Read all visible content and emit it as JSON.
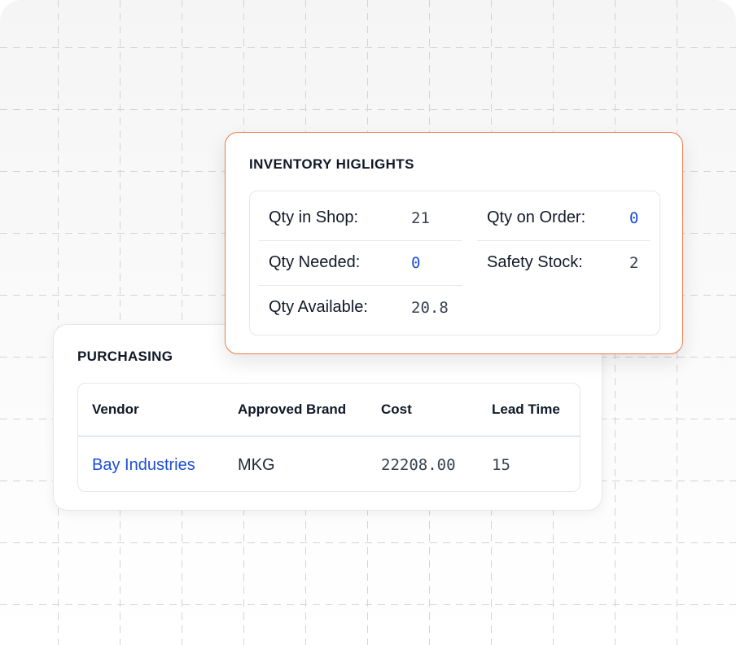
{
  "inventory": {
    "title": "INVENTORY HIGLIGHTS",
    "stats": [
      {
        "label": "Qty in Shop:",
        "value": "21"
      },
      {
        "label": "Qty on Order:",
        "value": "0"
      },
      {
        "label": "Qty Needed:",
        "value": "0"
      },
      {
        "label": "Safety Stock:",
        "value": "2"
      },
      {
        "label": "Qty Available:",
        "value": "20.8"
      }
    ]
  },
  "purchasing": {
    "title": "PURCHASING",
    "columns": [
      "Vendor",
      "Approved Brand",
      "Cost",
      "Lead Time"
    ],
    "rows": [
      {
        "vendor": "Bay Industries",
        "brand": "MKG",
        "cost": "22208.00",
        "lead_time": "15"
      }
    ]
  },
  "colors": {
    "accent_border": "#ed7a40",
    "link": "#1d4ed8",
    "header_rule": "#bfcdfa"
  }
}
